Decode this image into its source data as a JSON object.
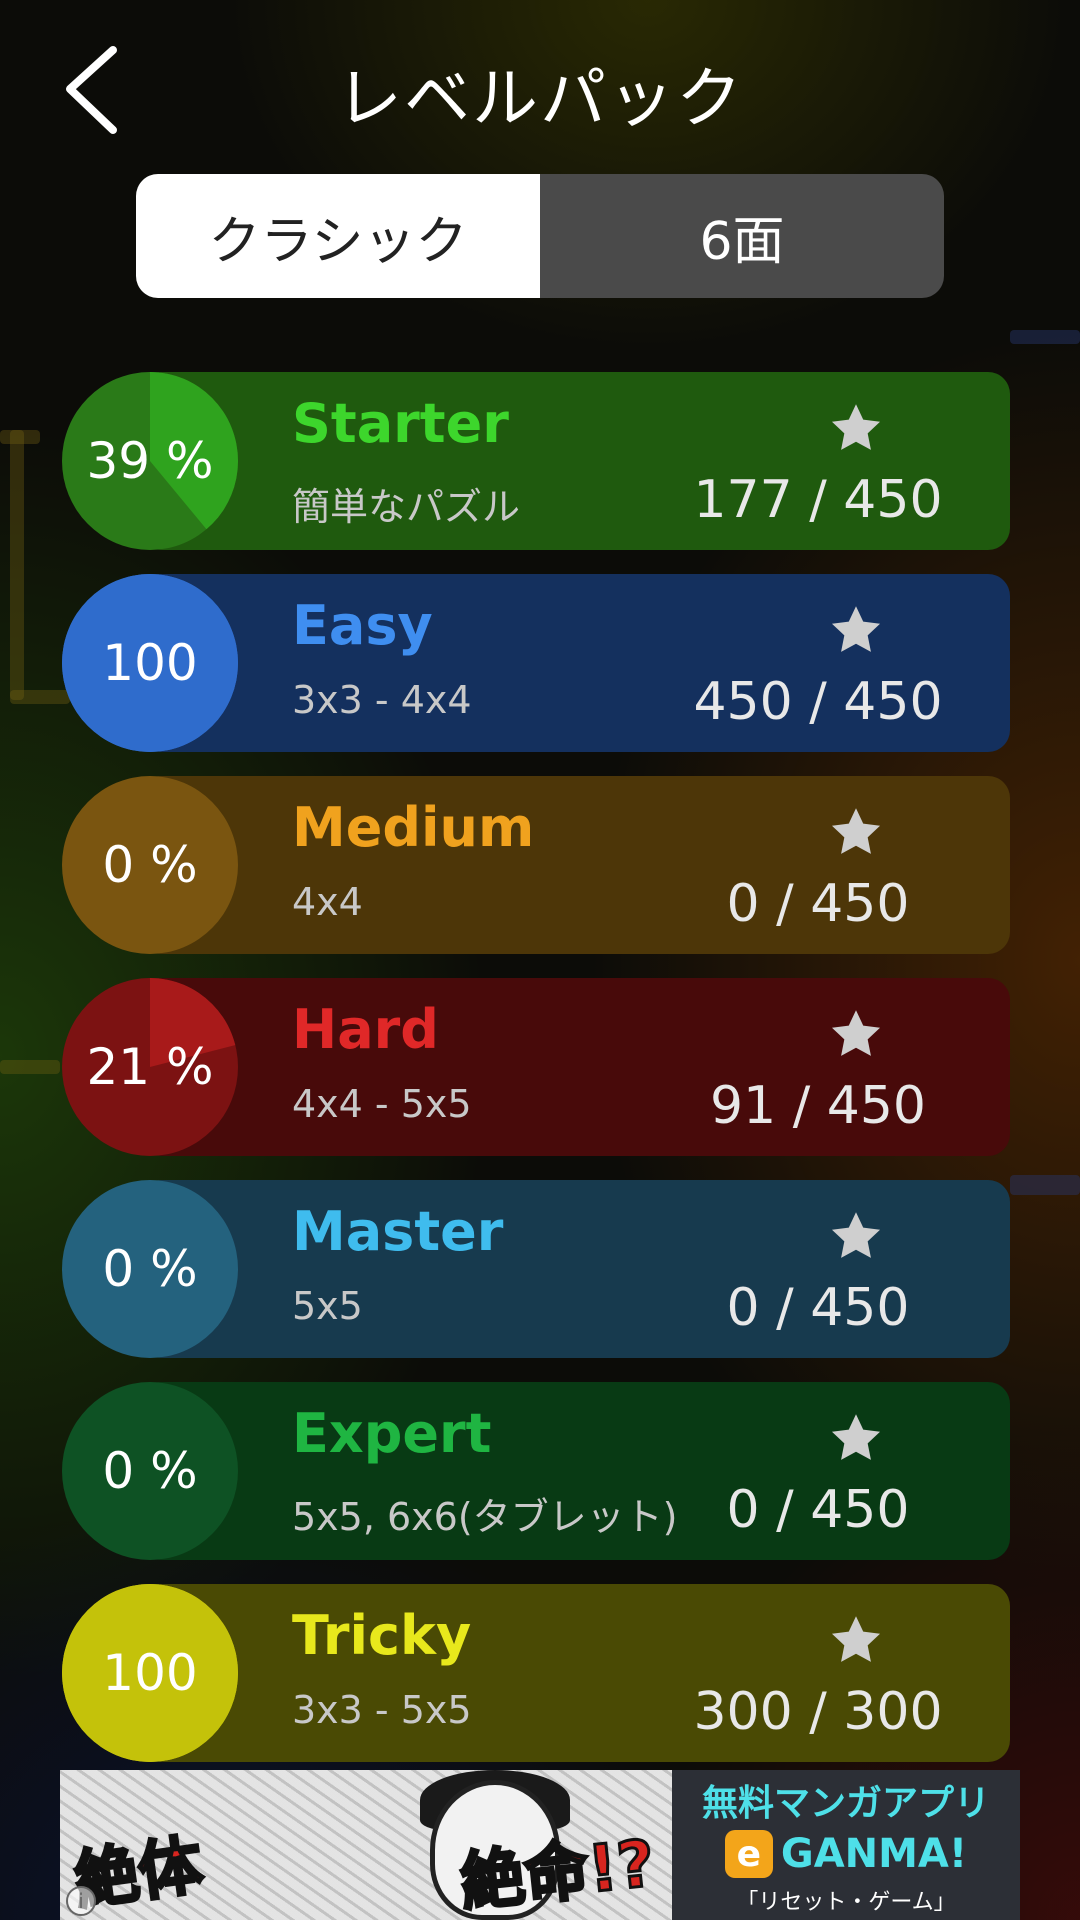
{
  "header": {
    "title": "レベルパック",
    "back_icon": "chevron-left-icon"
  },
  "tabs": [
    {
      "label": "クラシック",
      "selected": true
    },
    {
      "label": "6面",
      "selected": false
    }
  ],
  "packs": [
    {
      "name": "Starter",
      "subtitle": "簡単なパズル",
      "badge": "39 %",
      "progress": 0.39,
      "count": "177 / 450",
      "color": "#3dd62c",
      "band": "#1f5a0e",
      "badge_bg": "#2a7a18",
      "badge_fill": "#2fa31e"
    },
    {
      "name": "Easy",
      "subtitle": "3x3 - 4x4",
      "badge": "100",
      "progress": 1.0,
      "count": "450 / 450",
      "color": "#3f8ef0",
      "band": "#14305e",
      "badge_bg": "#2f6ccc",
      "badge_fill": "#2f6ccc"
    },
    {
      "name": "Medium",
      "subtitle": "4x4",
      "badge": "0 %",
      "progress": 0.0,
      "count": "0 / 450",
      "color": "#f0a21e",
      "band": "#4d3608",
      "badge_bg": "#7a5510",
      "badge_fill": "#9a6c14"
    },
    {
      "name": "Hard",
      "subtitle": "4x4 - 5x5",
      "badge": "21 %",
      "progress": 0.21,
      "count": "91 / 450",
      "color": "#e02828",
      "band": "#480a0a",
      "badge_bg": "#7c1212",
      "badge_fill": "#a81a1a"
    },
    {
      "name": "Master",
      "subtitle": "5x5",
      "badge": "0 %",
      "progress": 0.0,
      "count": "0 / 450",
      "color": "#3fbcee",
      "band": "#173a4e",
      "badge_bg": "#24627e",
      "badge_fill": "#2a7ea0"
    },
    {
      "name": "Expert",
      "subtitle": "5x5, 6x6(タブレット)",
      "badge": "0 %",
      "progress": 0.0,
      "count": "0 / 450",
      "color": "#1fb542",
      "band": "#083a14",
      "badge_bg": "#0e5224",
      "badge_fill": "#137030"
    },
    {
      "name": "Tricky",
      "subtitle": "3x3 - 5x5",
      "badge": "100",
      "progress": 1.0,
      "count": "300 / 300",
      "color": "#e8e81c",
      "band": "#4a4a04",
      "badge_bg": "#c4c20a",
      "badge_fill": "#c4c20a"
    }
  ],
  "ad": {
    "left_text1": "絶体",
    "left_text2": "絶命!?",
    "right_line1": "無料マンガアプリ",
    "right_logo": "e",
    "right_brand": "GANMA!",
    "right_line3": "「リセット・ゲーム」",
    "info_icon": "i"
  }
}
